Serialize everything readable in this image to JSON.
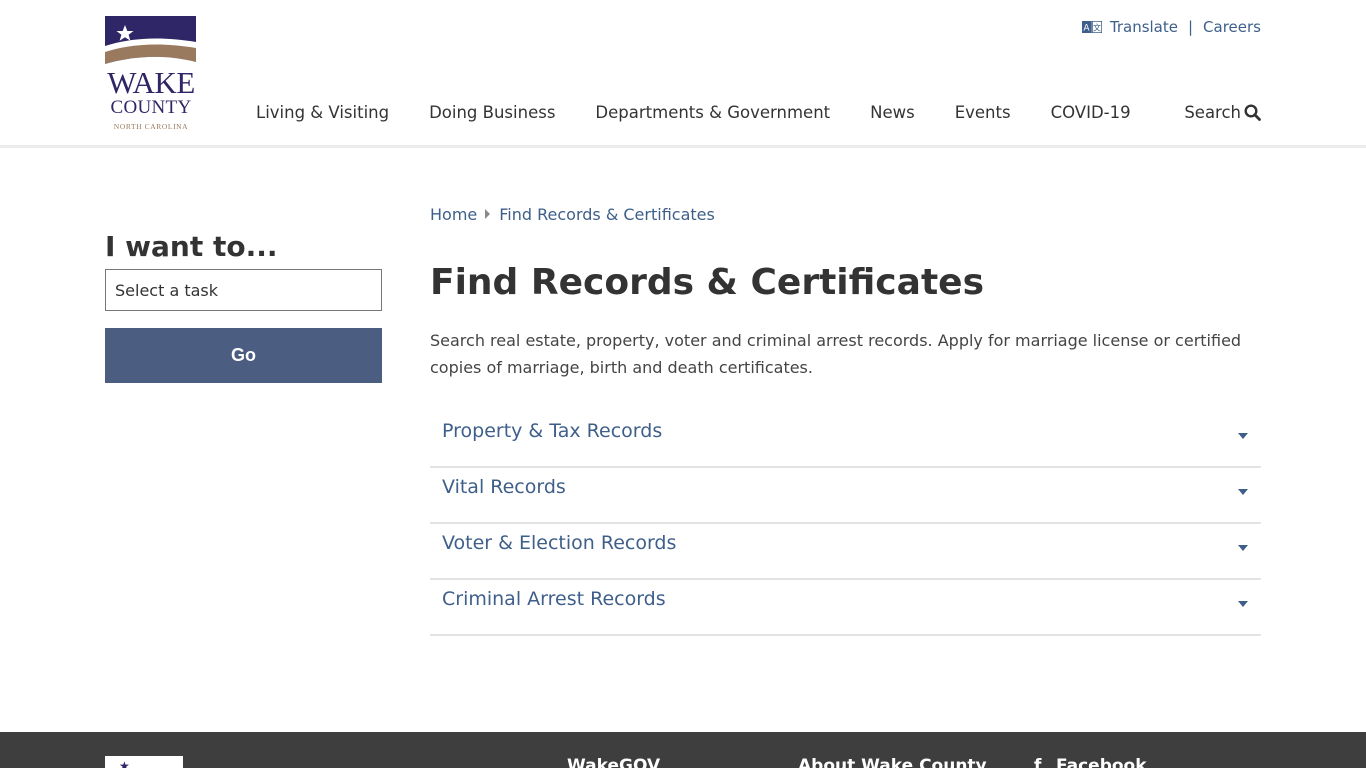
{
  "header": {
    "logo": {
      "line1": "WAKE",
      "line2": "COUNTY",
      "line3": "NORTH CAROLINA"
    },
    "utility": {
      "translate_label": "Translate",
      "separator": "|",
      "careers_label": "Careers"
    },
    "nav": [
      {
        "label": "Living & Visiting"
      },
      {
        "label": "Doing Business"
      },
      {
        "label": "Departments & Government"
      },
      {
        "label": "News"
      },
      {
        "label": "Events"
      },
      {
        "label": "COVID-19"
      }
    ],
    "search_label": "Search"
  },
  "sidebar": {
    "heading": "I want to...",
    "select_value": "Select a task",
    "go_label": "Go"
  },
  "breadcrumb": {
    "home": "Home",
    "current": "Find Records & Certificates"
  },
  "main": {
    "title": "Find Records & Certificates",
    "intro": "Search real estate, property, voter and criminal arrest records. Apply for marriage license or certified copies of marriage, birth and death certificates.",
    "accordion": [
      {
        "label": "Property & Tax Records"
      },
      {
        "label": "Vital Records"
      },
      {
        "label": "Voter & Election Records"
      },
      {
        "label": "Criminal Arrest Records"
      }
    ]
  },
  "footer": {
    "col1_heading": "WakeGOV",
    "col2_heading": "About Wake County",
    "col3_heading": "Facebook"
  },
  "colors": {
    "brand_purple": "#2e2666",
    "brand_brown": "#9a7a5e",
    "link_blue": "#3e5f8a",
    "button_blue": "#4b5d80",
    "footer_bg": "#3e3e3e"
  }
}
